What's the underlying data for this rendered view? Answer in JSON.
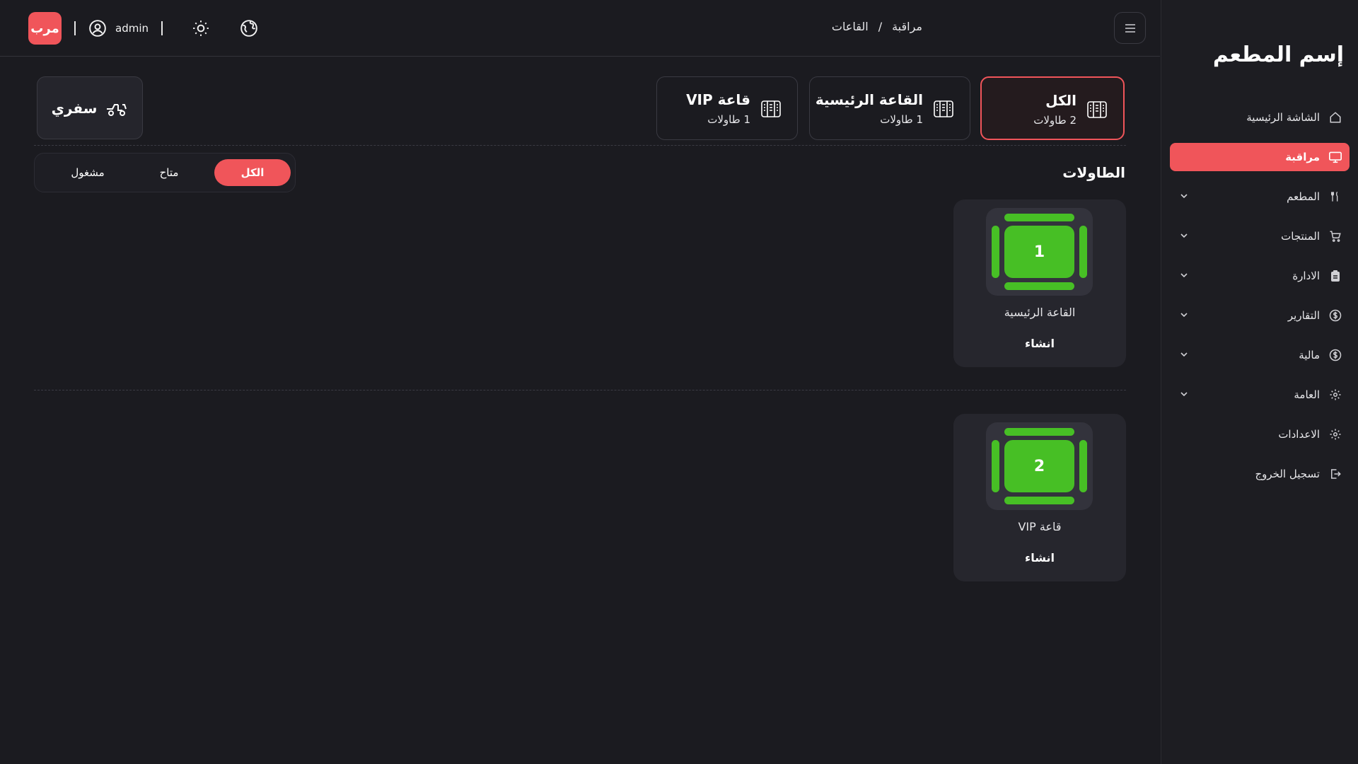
{
  "sidebar": {
    "brand": "إسم المطعم",
    "items": [
      {
        "label": "الشاشة الرئيسية",
        "icon": "home-icon"
      },
      {
        "label": "مراقبة",
        "icon": "monitor-icon"
      },
      {
        "label": "المطعم",
        "icon": "utensils-icon"
      },
      {
        "label": "المنتجات",
        "icon": "cart-icon"
      },
      {
        "label": "الادارة",
        "icon": "clipboard-icon"
      },
      {
        "label": "التقارير",
        "icon": "dollar-icon"
      },
      {
        "label": "مالية",
        "icon": "dollar-icon"
      },
      {
        "label": "العامة",
        "icon": "gear-icon"
      },
      {
        "label": "الاعدادات",
        "icon": "gear-icon"
      },
      {
        "label": "تسجيل الخروج",
        "icon": "logout-icon"
      }
    ]
  },
  "header": {
    "breadcrumb": [
      "مراقبة",
      "/",
      "القاعات"
    ],
    "username": "admin",
    "logo_text": "مرب"
  },
  "halls": [
    {
      "name": "الكل",
      "count": "2 طاولات"
    },
    {
      "name": "القاعة الرئيسية",
      "count": "1 طاولات"
    },
    {
      "name": "قاعة VIP",
      "count": "1 طاولات"
    }
  ],
  "sfry_label": "سفري",
  "tables_section": {
    "title": "الطاولات",
    "filters": [
      "الكل",
      "متاح",
      "مشغول"
    ]
  },
  "tables": [
    {
      "number": "1",
      "hall": "القاعة الرئيسية",
      "action": "انشاء"
    },
    {
      "number": "2",
      "hall": "قاعة VIP",
      "action": "انشاء"
    }
  ],
  "colors": {
    "accent": "#f0555a",
    "available": "#47bf25",
    "background": "#1b1b20"
  }
}
